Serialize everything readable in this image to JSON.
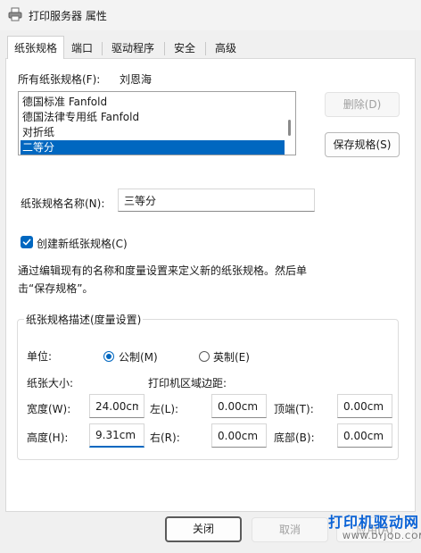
{
  "window": {
    "title": "打印服务器 属性"
  },
  "tabs": [
    {
      "label": "纸张规格"
    },
    {
      "label": "端口"
    },
    {
      "label": "驱动程序"
    },
    {
      "label": "安全"
    },
    {
      "label": "高级"
    }
  ],
  "forms": {
    "all_label": "所有纸张规格(F):",
    "owner": "刘恩海",
    "list_items": [
      "德国标准 Fanfold",
      "德国法律专用纸 Fanfold",
      "对折纸",
      "二等分"
    ],
    "selected_index": 3,
    "delete_button": "删除(D)",
    "save_button": "保存规格(S)",
    "name_label": "纸张规格名称(N):",
    "name_value": "三等分",
    "create_checkbox_label": "创建新纸张规格(C)",
    "create_checked": true,
    "description_line1": "通过编辑现有的名称和度量设置来定义新的纸张规格。然后单",
    "description_line2": "击“保存规格”。"
  },
  "measurements": {
    "group_title": "纸张规格描述(度量设置)",
    "unit_label": "单位:",
    "metric_label": "公制(M)",
    "english_label": "英制(E)",
    "metric_selected": true,
    "paper_size_label": "纸张大小:",
    "margins_label": "打印机区域边距:",
    "width_label": "宽度(W):",
    "width_value": "24.00cm",
    "height_label": "高度(H):",
    "height_value": "9.31cm",
    "left_label": "左(L):",
    "left_value": "0.00cm",
    "right_label": "右(R):",
    "right_value": "0.00cm",
    "top_label": "顶端(T):",
    "top_value": "0.00cm",
    "bottom_label": "底部(B):",
    "bottom_value": "0.00cm"
  },
  "footer": {
    "close_button": "关闭",
    "cancel_button": "取消",
    "apply_button": "应用(A)"
  },
  "watermark": {
    "main": "打印机驱动网",
    "sub": "WWW.DYJQD.COM"
  }
}
